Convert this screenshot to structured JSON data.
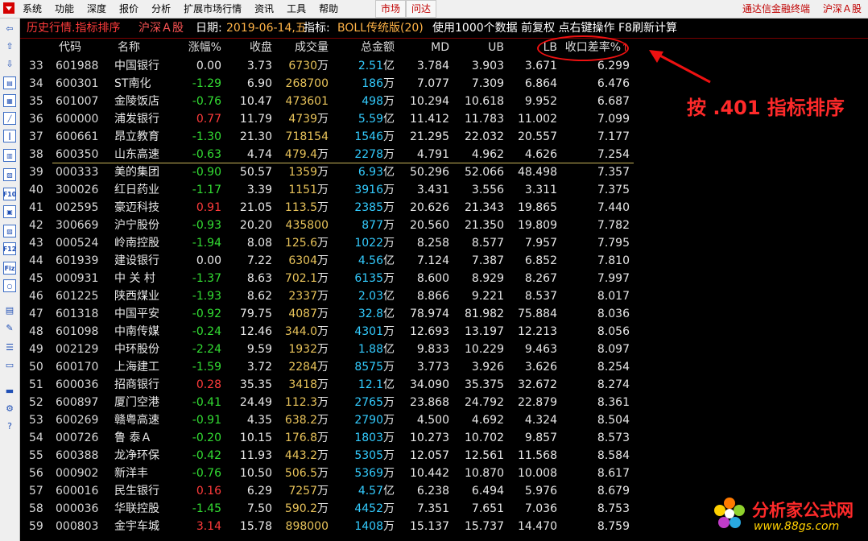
{
  "menu": {
    "items": [
      "系统",
      "功能",
      "深度",
      "报价",
      "分析",
      "扩展市场行情",
      "资讯",
      "工具",
      "帮助"
    ],
    "tabs": [
      "市场",
      "问达"
    ],
    "right": [
      "通达信金融终端",
      "沪深Ａ股"
    ]
  },
  "title": {
    "name": "历史行情.指标排序",
    "market": "沪深Ａ股",
    "date_label": "日期:",
    "date": "2019-06-14,五",
    "indicator_label": "指标:",
    "indicator": "BOLL传统版(20)",
    "rest": "使用1000个数据 前复权 点右键操作 F8刷新计算"
  },
  "columns": {
    "code": "代码",
    "name": "名称",
    "change": "涨幅%",
    "close": "收盘",
    "volume": "成交量",
    "amount": "总金额",
    "md": "MD",
    "ub": "UB",
    "lb": "LB",
    "rate": "收口差率%",
    "sort_arrow": "↑"
  },
  "rows": [
    {
      "num": "33",
      "code": "601988",
      "name": "中国银行",
      "change": "0.00",
      "sign": "zero",
      "close": "3.73",
      "vol": "6730",
      "vol_unit": "万",
      "amt": "2.51",
      "amt_unit": "亿",
      "md": "3.784",
      "ub": "3.903",
      "lb": "3.671",
      "rate": "6.299"
    },
    {
      "num": "34",
      "code": "600301",
      "name": "ST南化",
      "change": "-1.29",
      "sign": "neg",
      "close": "6.90",
      "vol": "268700",
      "vol_unit": "",
      "amt": "186",
      "amt_unit": "万",
      "md": "7.077",
      "ub": "7.309",
      "lb": "6.864",
      "rate": "6.476"
    },
    {
      "num": "35",
      "code": "601007",
      "name": "金陵饭店",
      "change": "-0.76",
      "sign": "neg",
      "close": "10.47",
      "vol": "473601",
      "vol_unit": "",
      "amt": "498",
      "amt_unit": "万",
      "md": "10.294",
      "ub": "10.618",
      "lb": "9.952",
      "rate": "6.687"
    },
    {
      "num": "36",
      "code": "600000",
      "name": "浦发银行",
      "change": "0.77",
      "sign": "pos",
      "close": "11.79",
      "vol": "4739",
      "vol_unit": "万",
      "amt": "5.59",
      "amt_unit": "亿",
      "md": "11.412",
      "ub": "11.783",
      "lb": "11.002",
      "rate": "7.099"
    },
    {
      "num": "37",
      "code": "600661",
      "name": "昂立教育",
      "change": "-1.30",
      "sign": "neg",
      "close": "21.30",
      "vol": "718154",
      "vol_unit": "",
      "amt": "1546",
      "amt_unit": "万",
      "md": "21.295",
      "ub": "22.032",
      "lb": "20.557",
      "rate": "7.177"
    },
    {
      "num": "38",
      "code": "600350",
      "name": "山东高速",
      "change": "-0.63",
      "sign": "neg",
      "close": "4.74",
      "vol": "479.4",
      "vol_unit": "万",
      "amt": "2278",
      "amt_unit": "万",
      "md": "4.791",
      "ub": "4.962",
      "lb": "4.626",
      "rate": "7.254"
    },
    {
      "num": "39",
      "code": "000333",
      "name": "美的集团",
      "change": "-0.90",
      "sign": "neg",
      "close": "50.57",
      "vol": "1359",
      "vol_unit": "万",
      "amt": "6.93",
      "amt_unit": "亿",
      "md": "50.296",
      "ub": "52.066",
      "lb": "48.498",
      "rate": "7.357"
    },
    {
      "num": "40",
      "code": "300026",
      "name": "红日药业",
      "change": "-1.17",
      "sign": "neg",
      "close": "3.39",
      "vol": "1151",
      "vol_unit": "万",
      "amt": "3916",
      "amt_unit": "万",
      "md": "3.431",
      "ub": "3.556",
      "lb": "3.311",
      "rate": "7.375"
    },
    {
      "num": "41",
      "code": "002595",
      "name": "豪迈科技",
      "change": "0.91",
      "sign": "pos",
      "close": "21.05",
      "vol": "113.5",
      "vol_unit": "万",
      "amt": "2385",
      "amt_unit": "万",
      "md": "20.626",
      "ub": "21.343",
      "lb": "19.865",
      "rate": "7.440"
    },
    {
      "num": "42",
      "code": "300669",
      "name": "沪宁股份",
      "change": "-0.93",
      "sign": "neg",
      "close": "20.20",
      "vol": "435800",
      "vol_unit": "",
      "amt": "877",
      "amt_unit": "万",
      "md": "20.560",
      "ub": "21.350",
      "lb": "19.809",
      "rate": "7.782"
    },
    {
      "num": "43",
      "code": "000524",
      "name": "岭南控股",
      "change": "-1.94",
      "sign": "neg",
      "close": "8.08",
      "vol": "125.6",
      "vol_unit": "万",
      "amt": "1022",
      "amt_unit": "万",
      "md": "8.258",
      "ub": "8.577",
      "lb": "7.957",
      "rate": "7.795"
    },
    {
      "num": "44",
      "code": "601939",
      "name": "建设银行",
      "change": "0.00",
      "sign": "zero",
      "close": "7.22",
      "vol": "6304",
      "vol_unit": "万",
      "amt": "4.56",
      "amt_unit": "亿",
      "md": "7.124",
      "ub": "7.387",
      "lb": "6.852",
      "rate": "7.810"
    },
    {
      "num": "45",
      "code": "000931",
      "name": "中 关 村",
      "change": "-1.37",
      "sign": "neg",
      "close": "8.63",
      "vol": "702.1",
      "vol_unit": "万",
      "amt": "6135",
      "amt_unit": "万",
      "md": "8.600",
      "ub": "8.929",
      "lb": "8.267",
      "rate": "7.997"
    },
    {
      "num": "46",
      "code": "601225",
      "name": "陕西煤业",
      "change": "-1.93",
      "sign": "neg",
      "close": "8.62",
      "vol": "2337",
      "vol_unit": "万",
      "amt": "2.03",
      "amt_unit": "亿",
      "md": "8.866",
      "ub": "9.221",
      "lb": "8.537",
      "rate": "8.017"
    },
    {
      "num": "47",
      "code": "601318",
      "name": "中国平安",
      "change": "-0.92",
      "sign": "neg",
      "close": "79.75",
      "vol": "4087",
      "vol_unit": "万",
      "amt": "32.8",
      "amt_unit": "亿",
      "md": "78.974",
      "ub": "81.982",
      "lb": "75.884",
      "rate": "8.036"
    },
    {
      "num": "48",
      "code": "601098",
      "name": "中南传媒",
      "change": "-0.24",
      "sign": "neg",
      "close": "12.46",
      "vol": "344.0",
      "vol_unit": "万",
      "amt": "4301",
      "amt_unit": "万",
      "md": "12.693",
      "ub": "13.197",
      "lb": "12.213",
      "rate": "8.056"
    },
    {
      "num": "49",
      "code": "002129",
      "name": "中环股份",
      "change": "-2.24",
      "sign": "neg",
      "close": "9.59",
      "vol": "1932",
      "vol_unit": "万",
      "amt": "1.88",
      "amt_unit": "亿",
      "md": "9.833",
      "ub": "10.229",
      "lb": "9.463",
      "rate": "8.097"
    },
    {
      "num": "50",
      "code": "600170",
      "name": "上海建工",
      "change": "-1.59",
      "sign": "neg",
      "close": "3.72",
      "vol": "2284",
      "vol_unit": "万",
      "amt": "8575",
      "amt_unit": "万",
      "md": "3.773",
      "ub": "3.926",
      "lb": "3.626",
      "rate": "8.254"
    },
    {
      "num": "51",
      "code": "600036",
      "name": "招商银行",
      "change": "0.28",
      "sign": "pos",
      "close": "35.35",
      "vol": "3418",
      "vol_unit": "万",
      "amt": "12.1",
      "amt_unit": "亿",
      "md": "34.090",
      "ub": "35.375",
      "lb": "32.672",
      "rate": "8.274"
    },
    {
      "num": "52",
      "code": "600897",
      "name": "厦门空港",
      "change": "-0.41",
      "sign": "neg",
      "close": "24.49",
      "vol": "112.3",
      "vol_unit": "万",
      "amt": "2765",
      "amt_unit": "万",
      "md": "23.868",
      "ub": "24.792",
      "lb": "22.879",
      "rate": "8.361"
    },
    {
      "num": "53",
      "code": "600269",
      "name": "赣粤高速",
      "change": "-0.91",
      "sign": "neg",
      "close": "4.35",
      "vol": "638.2",
      "vol_unit": "万",
      "amt": "2790",
      "amt_unit": "万",
      "md": "4.500",
      "ub": "4.692",
      "lb": "4.324",
      "rate": "8.504"
    },
    {
      "num": "54",
      "code": "000726",
      "name": "鲁 泰Ａ",
      "change": "-0.20",
      "sign": "neg",
      "close": "10.15",
      "vol": "176.8",
      "vol_unit": "万",
      "amt": "1803",
      "amt_unit": "万",
      "md": "10.273",
      "ub": "10.702",
      "lb": "9.857",
      "rate": "8.573"
    },
    {
      "num": "55",
      "code": "600388",
      "name": "龙净环保",
      "change": "-0.42",
      "sign": "neg",
      "close": "11.93",
      "vol": "443.2",
      "vol_unit": "万",
      "amt": "5305",
      "amt_unit": "万",
      "md": "12.057",
      "ub": "12.561",
      "lb": "11.568",
      "rate": "8.584"
    },
    {
      "num": "56",
      "code": "000902",
      "name": "新洋丰",
      "change": "-0.76",
      "sign": "neg",
      "close": "10.50",
      "vol": "506.5",
      "vol_unit": "万",
      "amt": "5369",
      "amt_unit": "万",
      "md": "10.442",
      "ub": "10.870",
      "lb": "10.008",
      "rate": "8.617"
    },
    {
      "num": "57",
      "code": "600016",
      "name": "民生银行",
      "change": "0.16",
      "sign": "pos",
      "close": "6.29",
      "vol": "7257",
      "vol_unit": "万",
      "amt": "4.57",
      "amt_unit": "亿",
      "md": "6.238",
      "ub": "6.494",
      "lb": "5.976",
      "rate": "8.679"
    },
    {
      "num": "58",
      "code": "000036",
      "name": "华联控股",
      "change": "-1.45",
      "sign": "neg",
      "close": "7.50",
      "vol": "590.2",
      "vol_unit": "万",
      "amt": "4452",
      "amt_unit": "万",
      "md": "7.351",
      "ub": "7.651",
      "lb": "7.036",
      "rate": "8.753"
    },
    {
      "num": "59",
      "code": "000803",
      "name": "金宇车城",
      "change": "3.14",
      "sign": "pos",
      "close": "15.78",
      "vol": "898000",
      "vol_unit": "",
      "amt": "1408",
      "amt_unit": "万",
      "md": "15.137",
      "ub": "15.737",
      "lb": "14.470",
      "rate": "8.759"
    }
  ],
  "annotation": "按 .401 指标排序",
  "watermark": {
    "title": "分析家公式网",
    "url": "www.88gs.com"
  },
  "colors": {
    "up": "#ff3b3b",
    "down": "#33dd33",
    "volume": "#e8c35a",
    "amount": "#33ccff",
    "annotation": "#ff2a2a"
  }
}
